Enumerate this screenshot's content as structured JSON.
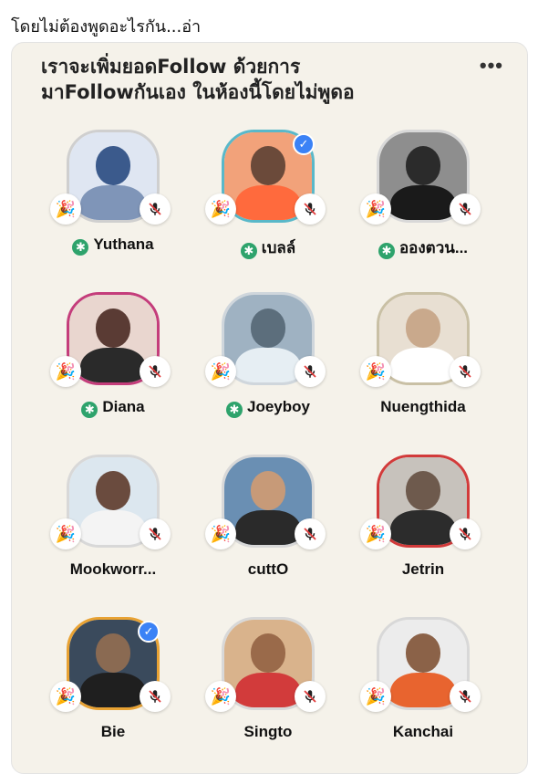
{
  "post": {
    "caption": "โดยไม่ต้องพูดอะไรกัน...อ่า"
  },
  "room": {
    "title_line1": "เราจะเพิ่มยอดFollow ด้วยการ",
    "title_line2": "มาFollowกันเอง ในห้องนี้โดยไม่พูดอ",
    "more_label": "•••"
  },
  "icons": {
    "party": "party-popper-icon",
    "mic_off": "muted-microphone-icon",
    "moderator": "moderator-star-icon",
    "verified": "verified-check-icon"
  },
  "speakers": [
    {
      "name": "Yuthana",
      "moderator": true,
      "verified": false,
      "ring": "#cfcfcf"
    },
    {
      "name": "เบลล์",
      "moderator": true,
      "verified": true,
      "ring": "#59b8c9"
    },
    {
      "name": "อองตวน...",
      "moderator": true,
      "verified": false,
      "ring": "#d8d8d8"
    },
    {
      "name": "Diana",
      "moderator": true,
      "verified": false,
      "ring": "#c43d7b"
    },
    {
      "name": "Joeyboy",
      "moderator": true,
      "verified": false,
      "ring": "#cfd6dc"
    },
    {
      "name": "Nuengthida",
      "moderator": false,
      "verified": false,
      "ring": "#c9c0a5"
    },
    {
      "name": "Mookworr...",
      "moderator": false,
      "verified": false,
      "ring": "#d8d8d8"
    },
    {
      "name": "cuttO",
      "moderator": false,
      "verified": false,
      "ring": "#d8d8d8"
    },
    {
      "name": "Jetrin",
      "moderator": false,
      "verified": false,
      "ring": "#d23a3a"
    },
    {
      "name": "Bie",
      "moderator": false,
      "verified": true,
      "ring": "#e8a233"
    },
    {
      "name": "Singto",
      "moderator": false,
      "verified": false,
      "ring": "#d8d8d8"
    },
    {
      "name": "Kanchai",
      "moderator": false,
      "verified": false,
      "ring": "#d8d8d8"
    }
  ]
}
